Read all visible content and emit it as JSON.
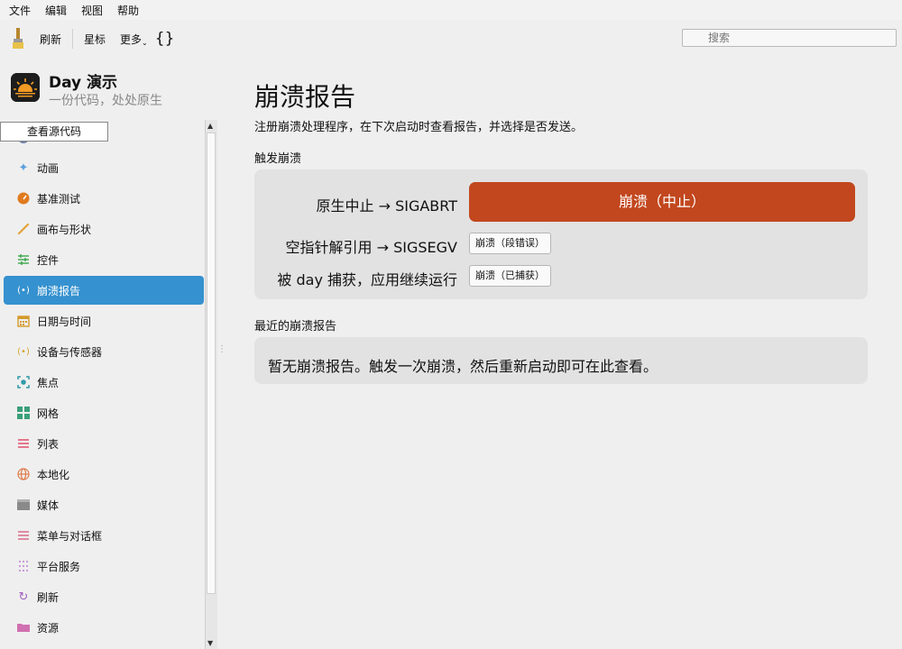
{
  "menubar": {
    "items": [
      "文件",
      "编辑",
      "视图",
      "帮助"
    ]
  },
  "toolbar": {
    "refresh_label": "刷新",
    "star_label": "星标",
    "more_label": "更多",
    "braces_label": "{}",
    "search_placeholder": "搜索"
  },
  "app": {
    "title": "Day 演示",
    "subtitle": "一份代码，处处原生"
  },
  "sidebar": {
    "view_source_label": "查看源代码",
    "items": [
      {
        "label": "动画",
        "icon": "sparkle-icon",
        "color": "#5ba0dc"
      },
      {
        "label": "基准测试",
        "icon": "gauge-icon",
        "color": "#e07b1f"
      },
      {
        "label": "画布与形状",
        "icon": "brush-icon",
        "color": "#e3a33a"
      },
      {
        "label": "控件",
        "icon": "sliders-icon",
        "color": "#3aa64a"
      },
      {
        "label": "崩溃报告",
        "icon": "broadcast-icon",
        "color": "#ffffff",
        "active": true
      },
      {
        "label": "日期与时间",
        "icon": "calendar-icon",
        "color": "#d49a2a"
      },
      {
        "label": "设备与传感器",
        "icon": "broadcast-icon",
        "color": "#d4a62a"
      },
      {
        "label": "焦点",
        "icon": "focus-icon",
        "color": "#2f9aa8"
      },
      {
        "label": "网格",
        "icon": "grid-icon",
        "color": "#3aa07a"
      },
      {
        "label": "列表",
        "icon": "list-icon",
        "color": "#e0506a"
      },
      {
        "label": "本地化",
        "icon": "globe-icon",
        "color": "#e07b4a"
      },
      {
        "label": "媒体",
        "icon": "clapper-icon",
        "color": "#8a8a8a"
      },
      {
        "label": "菜单与对话框",
        "icon": "menu-icon",
        "color": "#d86080"
      },
      {
        "label": "平台服务",
        "icon": "dots-icon",
        "color": "#c080d0"
      },
      {
        "label": "刷新",
        "icon": "refresh-icon",
        "color": "#a060c0"
      },
      {
        "label": "资源",
        "icon": "folder-icon",
        "color": "#d070b0"
      }
    ]
  },
  "main": {
    "title": "崩溃报告",
    "description": "注册崩溃处理程序，在下次启动时查看报告，并选择是否发送。",
    "trigger_heading": "触发崩溃",
    "rows": [
      {
        "label": "原生中止 → SIGABRT",
        "button": "崩溃（中止）"
      },
      {
        "label": "空指针解引用 → SIGSEGV",
        "button": "崩溃（段错误）"
      },
      {
        "label": "被 day 捕获，应用继续运行",
        "button": "崩溃（已捕获）"
      }
    ],
    "recent_heading": "最近的崩溃报告",
    "empty_text": "暂无崩溃报告。触发一次崩溃，然后重新启动即可在此查看。"
  },
  "colors": {
    "accent": "#3591cf",
    "danger_button": "#c2471e"
  }
}
